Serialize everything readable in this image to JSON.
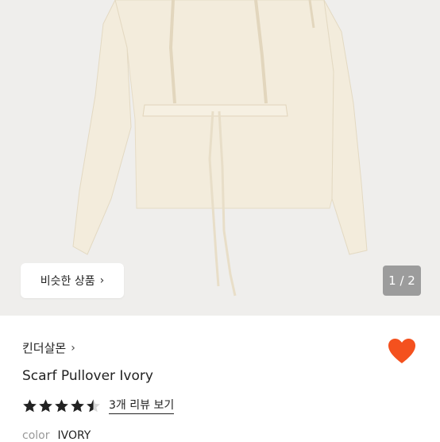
{
  "gallery": {
    "similar_button_label": "비슷한 상품",
    "similar_button_chevron": "›",
    "pager_text": "1 / 2"
  },
  "product": {
    "shop_name": "킨더살몬",
    "shop_chevron": "›",
    "title": "Scarf Pullover Ivory",
    "rating_stars": 4.5,
    "review_link": "3개 리뷰 보기",
    "spec_label": "color",
    "spec_value": "IVORY",
    "favorited": true
  },
  "colors": {
    "gallery_bg": "#efeeec",
    "garment": "#f3ecdc",
    "heart": "#f4511e",
    "pager_bg": "#9c9c9c"
  },
  "icons": {
    "heart": "heart-icon",
    "star": "star-icon",
    "chevron": "chevron-right-icon"
  }
}
